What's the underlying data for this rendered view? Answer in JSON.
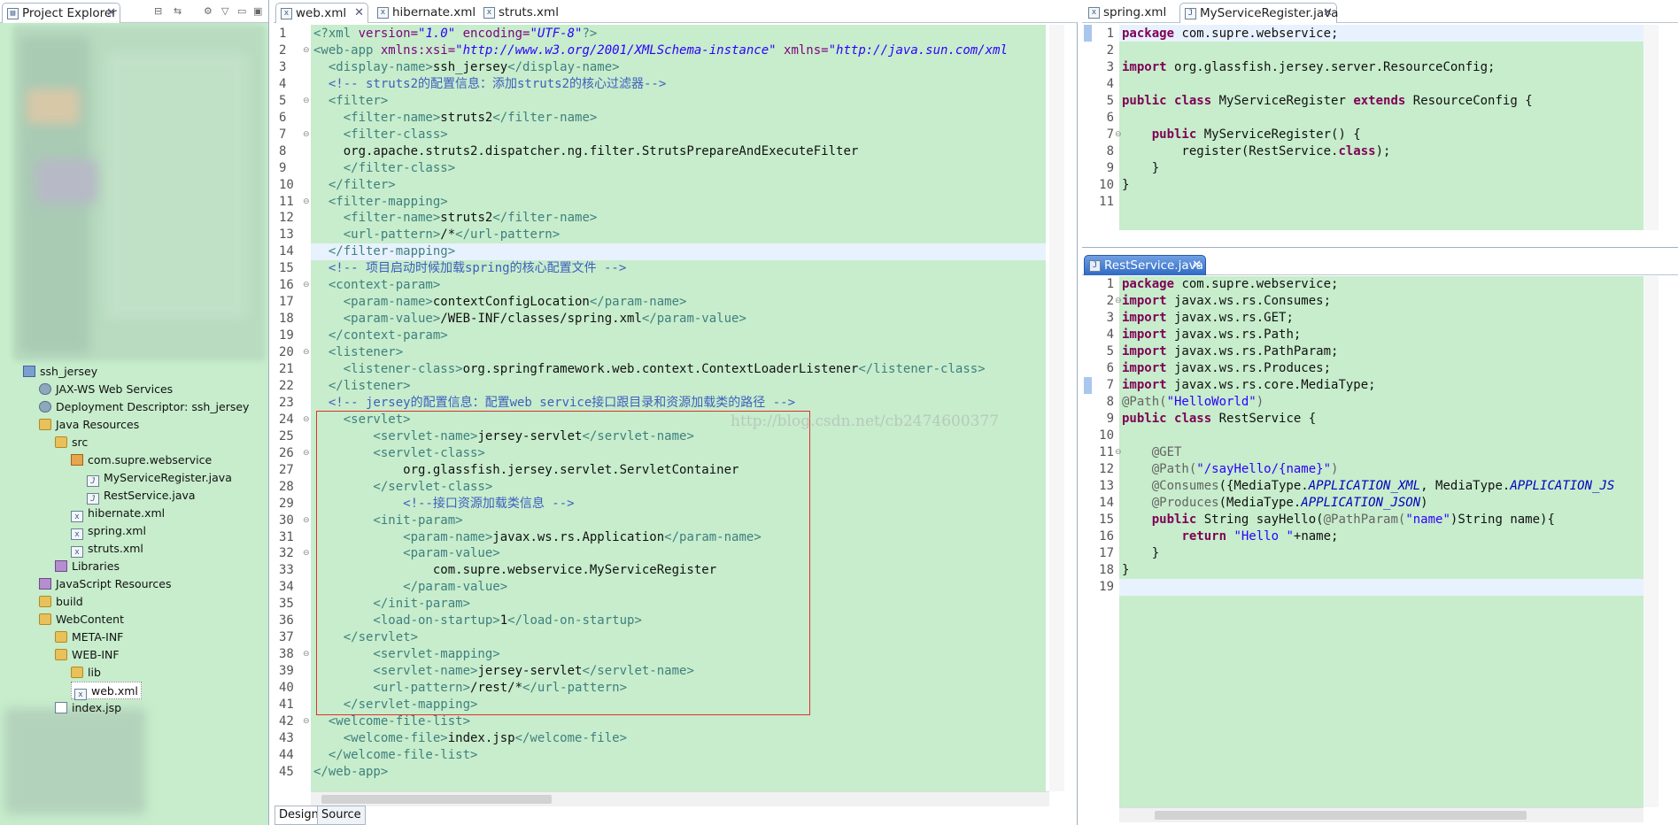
{
  "explorer": {
    "tab_label": "Project Explorer",
    "tree": [
      {
        "label": "ssh_jersey",
        "icon": "project-icon",
        "level": 0
      },
      {
        "label": "JAX-WS Web Services",
        "icon": "webservice-icon",
        "level": 1
      },
      {
        "label": "Deployment Descriptor: ssh_jersey",
        "icon": "descriptor-icon",
        "level": 1
      },
      {
        "label": "Java Resources",
        "icon": "folder-icon",
        "level": 1
      },
      {
        "label": "src",
        "icon": "folder-icon",
        "level": 2
      },
      {
        "label": "com.supre.webservice",
        "icon": "package-icon",
        "level": 3
      },
      {
        "label": "MyServiceRegister.java",
        "icon": "java-file-icon",
        "level": 4
      },
      {
        "label": "RestService.java",
        "icon": "java-file-icon",
        "level": 4
      },
      {
        "label": "hibernate.xml",
        "icon": "xml-file-icon",
        "level": 3
      },
      {
        "label": "spring.xml",
        "icon": "xml-file-icon",
        "level": 3
      },
      {
        "label": "struts.xml",
        "icon": "xml-file-icon",
        "level": 3
      },
      {
        "label": "Libraries",
        "icon": "library-icon",
        "level": 2
      },
      {
        "label": "JavaScript Resources",
        "icon": "library-icon",
        "level": 1
      },
      {
        "label": "build",
        "icon": "folder-icon",
        "level": 1
      },
      {
        "label": "WebContent",
        "icon": "folder-icon",
        "level": 1
      },
      {
        "label": "META-INF",
        "icon": "folder-icon",
        "level": 2
      },
      {
        "label": "WEB-INF",
        "icon": "folder-icon",
        "level": 2
      },
      {
        "label": "lib",
        "icon": "folder-icon",
        "level": 3
      },
      {
        "label": "web.xml",
        "icon": "xml-file-icon",
        "level": 3,
        "selected": true
      },
      {
        "label": "index.jsp",
        "icon": "jsp-file-icon",
        "level": 2
      }
    ]
  },
  "webxml_editor": {
    "tabs": [
      {
        "label": "web.xml",
        "active": true
      },
      {
        "label": "hibernate.xml",
        "active": false
      },
      {
        "label": "struts.xml",
        "active": false
      }
    ],
    "bottom_tabs": [
      "Design",
      "Source"
    ],
    "watermark": "http://blog.csdn.net/cb2474600377",
    "lines": [
      [
        [
          "<?",
          "t"
        ],
        [
          "xml ",
          "t"
        ],
        [
          "version=",
          "a"
        ],
        [
          "\"1.0\"",
          "s"
        ],
        [
          " encoding=",
          "a"
        ],
        [
          "\"UTF-8\"",
          "s"
        ],
        [
          "?>",
          "t"
        ]
      ],
      [
        [
          "<web-app ",
          "t"
        ],
        [
          "xmlns:xsi=",
          "a"
        ],
        [
          "\"http://www.w3.org/2001/XMLSchema-instance\"",
          "s"
        ],
        [
          " xmlns=",
          "a"
        ],
        [
          "\"http://java.sun.com/xml",
          "s"
        ]
      ],
      [
        [
          "  <display-name>",
          "t"
        ],
        [
          "ssh_jersey",
          "b"
        ],
        [
          "</display-name>",
          "t"
        ]
      ],
      [
        [
          "  <!-- struts2的配置信息：添加struts2的核心过滤器-->",
          "c"
        ]
      ],
      [
        [
          "  <filter>",
          "t"
        ]
      ],
      [
        [
          "    <filter-name>",
          "t"
        ],
        [
          "struts2",
          "b"
        ],
        [
          "</filter-name>",
          "t"
        ]
      ],
      [
        [
          "    <filter-class>",
          "t"
        ]
      ],
      [
        [
          "    org.apache.struts2.dispatcher.ng.filter.StrutsPrepareAndExecuteFilter",
          "b"
        ]
      ],
      [
        [
          "    </filter-class>",
          "t"
        ]
      ],
      [
        [
          "  </filter>",
          "t"
        ]
      ],
      [
        [
          "  <filter-mapping>",
          "t"
        ]
      ],
      [
        [
          "    <filter-name>",
          "t"
        ],
        [
          "struts2",
          "b"
        ],
        [
          "</filter-name>",
          "t"
        ]
      ],
      [
        [
          "    <url-pattern>",
          "t"
        ],
        [
          "/*",
          "b"
        ],
        [
          "</url-pattern>",
          "t"
        ]
      ],
      [
        [
          "  </filter-mapping>",
          "t"
        ]
      ],
      [
        [
          "  <!-- 项目启动时候加载spring的核心配置文件 -->",
          "c"
        ]
      ],
      [
        [
          "  <context-param>",
          "t"
        ]
      ],
      [
        [
          "    <param-name>",
          "t"
        ],
        [
          "contextConfigLocation",
          "b"
        ],
        [
          "</param-name>",
          "t"
        ]
      ],
      [
        [
          "    <param-value>",
          "t"
        ],
        [
          "/WEB-INF/classes/spring.xml",
          "b"
        ],
        [
          "</param-value>",
          "t"
        ]
      ],
      [
        [
          "  </context-param>",
          "t"
        ]
      ],
      [
        [
          "  <listener>",
          "t"
        ]
      ],
      [
        [
          "    <listener-class>",
          "t"
        ],
        [
          "org.springframework.web.context.ContextLoaderListener",
          "b"
        ],
        [
          "</listener-class>",
          "t"
        ]
      ],
      [
        [
          "  </listener>",
          "t"
        ]
      ],
      [
        [
          "  <!-- jersey的配置信息：配置web service接口跟目录和资源加载类的路径 -->",
          "c"
        ]
      ],
      [
        [
          "    <servlet>",
          "t"
        ]
      ],
      [
        [
          "        <servlet-name>",
          "t"
        ],
        [
          "jersey-servlet",
          "b"
        ],
        [
          "</servlet-name>",
          "t"
        ]
      ],
      [
        [
          "        <servlet-class>",
          "t"
        ]
      ],
      [
        [
          "            org.glassfish.jersey.servlet.ServletContainer",
          "b"
        ]
      ],
      [
        [
          "        </servlet-class>",
          "t"
        ]
      ],
      [
        [
          "            <!--接口资源加载类信息 -->",
          "c"
        ]
      ],
      [
        [
          "        <init-param>",
          "t"
        ]
      ],
      [
        [
          "            <param-name>",
          "t"
        ],
        [
          "javax.ws.rs.Application",
          "b"
        ],
        [
          "</param-name>",
          "t"
        ]
      ],
      [
        [
          "            <param-value>",
          "t"
        ]
      ],
      [
        [
          "                com.supre.webservice.MyServiceRegister",
          "b"
        ]
      ],
      [
        [
          "            </param-value>",
          "t"
        ]
      ],
      [
        [
          "        </init-param>",
          "t"
        ]
      ],
      [
        [
          "        <load-on-startup>",
          "t"
        ],
        [
          "1",
          "b"
        ],
        [
          "</load-on-startup>",
          "t"
        ]
      ],
      [
        [
          "    </servlet>",
          "t"
        ]
      ],
      [
        [
          "        <servlet-mapping>",
          "t"
        ]
      ],
      [
        [
          "        <servlet-name>",
          "t"
        ],
        [
          "jersey-servlet",
          "b"
        ],
        [
          "</servlet-name>",
          "t"
        ]
      ],
      [
        [
          "        <url-pattern>",
          "t"
        ],
        [
          "/rest/*",
          "b"
        ],
        [
          "</url-pattern>",
          "t"
        ]
      ],
      [
        [
          "    </servlet-mapping>",
          "t"
        ]
      ],
      [
        [
          "  <welcome-file-list>",
          "t"
        ]
      ],
      [
        [
          "    <welcome-file>",
          "t"
        ],
        [
          "index.jsp",
          "b"
        ],
        [
          "</welcome-file>",
          "t"
        ]
      ],
      [
        [
          "  </welcome-file-list>",
          "t"
        ]
      ],
      [
        [
          "</web-app>",
          "t"
        ]
      ]
    ]
  },
  "msr_editor": {
    "tabs": [
      {
        "label": "spring.xml",
        "active": false
      },
      {
        "label": "MyServiceRegister.java",
        "active": true
      }
    ],
    "lines": [
      [
        [
          "package",
          "k"
        ],
        [
          " com.supre.webservice;",
          "b"
        ]
      ],
      [],
      [
        [
          "import",
          "k"
        ],
        [
          " org.glassfish.jersey.server.ResourceConfig;",
          "b"
        ]
      ],
      [],
      [
        [
          "public",
          "k"
        ],
        [
          " ",
          "b"
        ],
        [
          "class",
          "k"
        ],
        [
          " MyServiceRegister ",
          "b"
        ],
        [
          "extends",
          "k"
        ],
        [
          " ResourceConfig {",
          "b"
        ]
      ],
      [],
      [
        [
          "    ",
          "b"
        ],
        [
          "public",
          "k"
        ],
        [
          " MyServiceRegister() {",
          "b"
        ]
      ],
      [
        [
          "        register(RestService.",
          "b"
        ],
        [
          "class",
          "k"
        ],
        [
          ");",
          "b"
        ]
      ],
      [
        [
          "    }",
          "b"
        ]
      ],
      [
        [
          "}",
          "b"
        ]
      ],
      []
    ]
  },
  "rest_editor": {
    "tabs": [
      {
        "label": "RestService.java",
        "active": true
      }
    ],
    "lines": [
      [
        [
          "package",
          "k"
        ],
        [
          " com.supre.webservice;",
          "b"
        ]
      ],
      [
        [
          "import",
          "k"
        ],
        [
          " javax.ws.rs.Consumes;",
          "b"
        ]
      ],
      [
        [
          "import",
          "k"
        ],
        [
          " javax.ws.rs.GET;",
          "b"
        ]
      ],
      [
        [
          "import",
          "k"
        ],
        [
          " javax.ws.rs.Path;",
          "b"
        ]
      ],
      [
        [
          "import",
          "k"
        ],
        [
          " javax.ws.rs.PathParam;",
          "b"
        ]
      ],
      [
        [
          "import",
          "k"
        ],
        [
          " javax.ws.rs.Produces;",
          "b"
        ]
      ],
      [
        [
          "import",
          "k"
        ],
        [
          " javax.ws.rs.core.MediaType;",
          "b"
        ]
      ],
      [
        [
          "@Path(",
          "an"
        ],
        [
          "\"HelloWorld\"",
          "sj"
        ],
        [
          ")",
          "an"
        ]
      ],
      [
        [
          "public",
          "k"
        ],
        [
          " ",
          "b"
        ],
        [
          "class",
          "k"
        ],
        [
          " RestService {",
          "b"
        ]
      ],
      [],
      [
        [
          "    @GET",
          "an"
        ]
      ],
      [
        [
          "    @Path(",
          "an"
        ],
        [
          "\"/sayHello/{name}\"",
          "sj"
        ],
        [
          ")",
          "an"
        ]
      ],
      [
        [
          "    @Consumes",
          "an"
        ],
        [
          "({MediaType.",
          "b"
        ],
        [
          "APPLICATION_XML",
          "f"
        ],
        [
          ", MediaType.",
          "b"
        ],
        [
          "APPLICATION_JS",
          "f"
        ]
      ],
      [
        [
          "    @Produces",
          "an"
        ],
        [
          "(MediaType.",
          "b"
        ],
        [
          "APPLICATION_JSON",
          "f"
        ],
        [
          ")",
          "b"
        ]
      ],
      [
        [
          "    ",
          "b"
        ],
        [
          "public",
          "k"
        ],
        [
          " String sayHello(",
          "b"
        ],
        [
          "@PathParam(",
          "an"
        ],
        [
          "\"name\"",
          "sj"
        ],
        [
          ")String name){",
          "b"
        ]
      ],
      [
        [
          "        ",
          "b"
        ],
        [
          "return",
          "k"
        ],
        [
          " ",
          "b"
        ],
        [
          "\"Hello \"",
          "sj"
        ],
        [
          "+name;",
          "b"
        ]
      ],
      [
        [
          "    }",
          "b"
        ]
      ],
      [
        [
          "}",
          "b"
        ]
      ],
      []
    ]
  }
}
